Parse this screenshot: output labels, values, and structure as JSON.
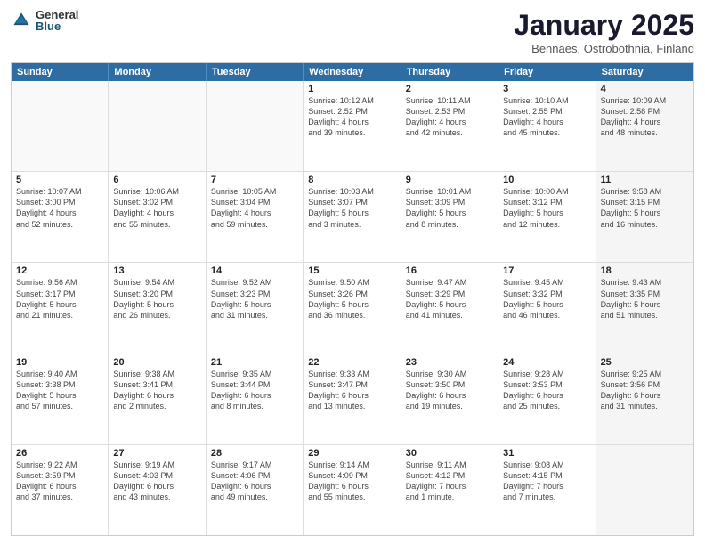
{
  "header": {
    "logo_general": "General",
    "logo_blue": "Blue",
    "month_title": "January 2025",
    "subtitle": "Bennaes, Ostrobothnia, Finland"
  },
  "days_of_week": [
    "Sunday",
    "Monday",
    "Tuesday",
    "Wednesday",
    "Thursday",
    "Friday",
    "Saturday"
  ],
  "weeks": [
    [
      {
        "day": "",
        "info": "",
        "empty": true
      },
      {
        "day": "",
        "info": "",
        "empty": true
      },
      {
        "day": "",
        "info": "",
        "empty": true
      },
      {
        "day": "1",
        "info": "Sunrise: 10:12 AM\nSunset: 2:52 PM\nDaylight: 4 hours\nand 39 minutes."
      },
      {
        "day": "2",
        "info": "Sunrise: 10:11 AM\nSunset: 2:53 PM\nDaylight: 4 hours\nand 42 minutes."
      },
      {
        "day": "3",
        "info": "Sunrise: 10:10 AM\nSunset: 2:55 PM\nDaylight: 4 hours\nand 45 minutes."
      },
      {
        "day": "4",
        "info": "Sunrise: 10:09 AM\nSunset: 2:58 PM\nDaylight: 4 hours\nand 48 minutes.",
        "shaded": true
      }
    ],
    [
      {
        "day": "5",
        "info": "Sunrise: 10:07 AM\nSunset: 3:00 PM\nDaylight: 4 hours\nand 52 minutes."
      },
      {
        "day": "6",
        "info": "Sunrise: 10:06 AM\nSunset: 3:02 PM\nDaylight: 4 hours\nand 55 minutes."
      },
      {
        "day": "7",
        "info": "Sunrise: 10:05 AM\nSunset: 3:04 PM\nDaylight: 4 hours\nand 59 minutes."
      },
      {
        "day": "8",
        "info": "Sunrise: 10:03 AM\nSunset: 3:07 PM\nDaylight: 5 hours\nand 3 minutes."
      },
      {
        "day": "9",
        "info": "Sunrise: 10:01 AM\nSunset: 3:09 PM\nDaylight: 5 hours\nand 8 minutes."
      },
      {
        "day": "10",
        "info": "Sunrise: 10:00 AM\nSunset: 3:12 PM\nDaylight: 5 hours\nand 12 minutes."
      },
      {
        "day": "11",
        "info": "Sunrise: 9:58 AM\nSunset: 3:15 PM\nDaylight: 5 hours\nand 16 minutes.",
        "shaded": true
      }
    ],
    [
      {
        "day": "12",
        "info": "Sunrise: 9:56 AM\nSunset: 3:17 PM\nDaylight: 5 hours\nand 21 minutes."
      },
      {
        "day": "13",
        "info": "Sunrise: 9:54 AM\nSunset: 3:20 PM\nDaylight: 5 hours\nand 26 minutes."
      },
      {
        "day": "14",
        "info": "Sunrise: 9:52 AM\nSunset: 3:23 PM\nDaylight: 5 hours\nand 31 minutes."
      },
      {
        "day": "15",
        "info": "Sunrise: 9:50 AM\nSunset: 3:26 PM\nDaylight: 5 hours\nand 36 minutes."
      },
      {
        "day": "16",
        "info": "Sunrise: 9:47 AM\nSunset: 3:29 PM\nDaylight: 5 hours\nand 41 minutes."
      },
      {
        "day": "17",
        "info": "Sunrise: 9:45 AM\nSunset: 3:32 PM\nDaylight: 5 hours\nand 46 minutes."
      },
      {
        "day": "18",
        "info": "Sunrise: 9:43 AM\nSunset: 3:35 PM\nDaylight: 5 hours\nand 51 minutes.",
        "shaded": true
      }
    ],
    [
      {
        "day": "19",
        "info": "Sunrise: 9:40 AM\nSunset: 3:38 PM\nDaylight: 5 hours\nand 57 minutes."
      },
      {
        "day": "20",
        "info": "Sunrise: 9:38 AM\nSunset: 3:41 PM\nDaylight: 6 hours\nand 2 minutes."
      },
      {
        "day": "21",
        "info": "Sunrise: 9:35 AM\nSunset: 3:44 PM\nDaylight: 6 hours\nand 8 minutes."
      },
      {
        "day": "22",
        "info": "Sunrise: 9:33 AM\nSunset: 3:47 PM\nDaylight: 6 hours\nand 13 minutes."
      },
      {
        "day": "23",
        "info": "Sunrise: 9:30 AM\nSunset: 3:50 PM\nDaylight: 6 hours\nand 19 minutes."
      },
      {
        "day": "24",
        "info": "Sunrise: 9:28 AM\nSunset: 3:53 PM\nDaylight: 6 hours\nand 25 minutes."
      },
      {
        "day": "25",
        "info": "Sunrise: 9:25 AM\nSunset: 3:56 PM\nDaylight: 6 hours\nand 31 minutes.",
        "shaded": true
      }
    ],
    [
      {
        "day": "26",
        "info": "Sunrise: 9:22 AM\nSunset: 3:59 PM\nDaylight: 6 hours\nand 37 minutes."
      },
      {
        "day": "27",
        "info": "Sunrise: 9:19 AM\nSunset: 4:03 PM\nDaylight: 6 hours\nand 43 minutes."
      },
      {
        "day": "28",
        "info": "Sunrise: 9:17 AM\nSunset: 4:06 PM\nDaylight: 6 hours\nand 49 minutes."
      },
      {
        "day": "29",
        "info": "Sunrise: 9:14 AM\nSunset: 4:09 PM\nDaylight: 6 hours\nand 55 minutes."
      },
      {
        "day": "30",
        "info": "Sunrise: 9:11 AM\nSunset: 4:12 PM\nDaylight: 7 hours\nand 1 minute."
      },
      {
        "day": "31",
        "info": "Sunrise: 9:08 AM\nSunset: 4:15 PM\nDaylight: 7 hours\nand 7 minutes."
      },
      {
        "day": "",
        "info": "",
        "empty": true,
        "shaded": true
      }
    ]
  ]
}
